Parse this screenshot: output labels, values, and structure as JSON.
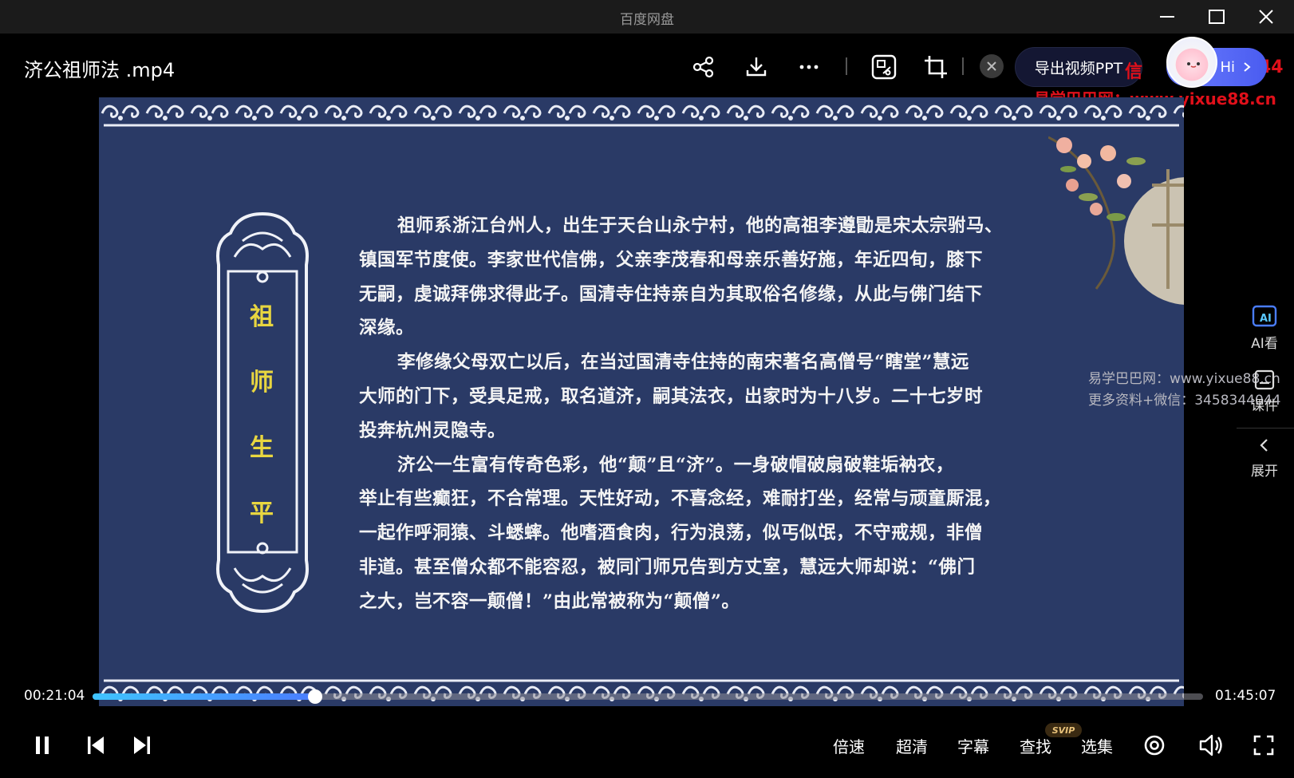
{
  "window": {
    "title": "百度网盘"
  },
  "header": {
    "file_title": "济公祖师法 .mp4",
    "export_ppt_label": "导出视频PPT",
    "hi_label": "Hi",
    "watermark_url": "易学巴巴网：www.yixue88.cn",
    "watermark_partial_left": "信",
    "watermark_partial_right": "44"
  },
  "video": {
    "vertical_title": [
      "祖",
      "师",
      "生",
      "平"
    ],
    "paragraphs": [
      {
        "lines": [
          "祖师系浙江台州人，出生于天台山永宁村，他的高祖李遵勖是宋太宗驸马、",
          "镇国军节度使。李家世代信佛，父亲李茂春和母亲乐善好施，年近四旬，膝下",
          "无嗣，虔诚拜佛求得此子。国清寺住持亲自为其取俗名修缘，从此与佛门结下",
          "深缘。"
        ]
      },
      {
        "lines": [
          "李修缘父母双亡以后，在当过国清寺住持的南宋著名高僧号“瞎堂”慧远",
          "大师的门下，受具足戒，取名道济，嗣其法衣，出家时为十八岁。二十七岁时",
          "投奔杭州灵隐寺。"
        ]
      },
      {
        "lines": [
          "济公一生富有传奇色彩，他“颠”且“济”。一身破帽破扇破鞋垢衲衣，",
          "举止有些癫狂，不合常理。天性好动，不喜念经，难耐打坐，经常与顽童厮混，",
          "一起作呼洞猿、斗蟋蟀。他嗜酒食肉，行为浪荡，似丐似氓，不守戒规，非僧",
          "非道。甚至僧众都不能容忍，被同门师兄告到方丈室，慧远大师却说：“佛门",
          "之大，岂不容一颠僧！”由此常被称为“颠僧”。"
        ]
      }
    ],
    "watermark_line1": "易学巴巴网：www.yixue88.cn",
    "watermark_line2": "更多资料+微信：3458344044"
  },
  "side_panel": {
    "ai_label": "AI看",
    "course_label": "课件",
    "expand_label": "展开"
  },
  "player": {
    "current_time": "00:21:04",
    "total_time": "01:45:07",
    "progress": 0.2005,
    "speed_label": "倍速",
    "quality_label": "超清",
    "subtitle_label": "字幕",
    "search_label": "查找",
    "svip_badge": "SVIP",
    "episodes_label": "选集"
  },
  "colors": {
    "slide_background": "#2a3a66",
    "vertical_title": "#e8d640",
    "watermark_red": "#e0101a",
    "progress_fill": "#3fc4ff",
    "export_button_bg": "#141733"
  }
}
